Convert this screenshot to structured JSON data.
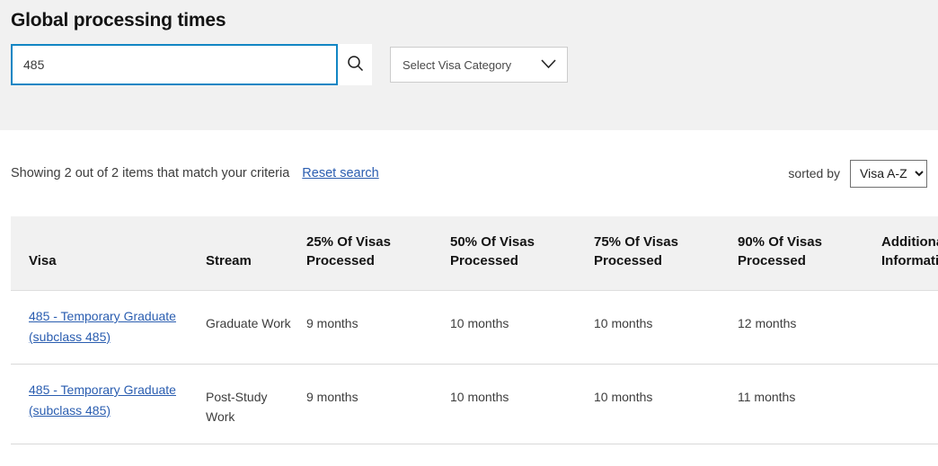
{
  "header": {
    "title": "Global processing times"
  },
  "search": {
    "value": "485",
    "placeholder": "",
    "search_icon": "search-icon",
    "category_label": "Select Visa Category",
    "category_caret": "chevron-down-icon"
  },
  "results": {
    "count_text": "Showing 2 out of 2 items that match your criteria",
    "reset_label": "Reset search",
    "sorted_by_label": "sorted by",
    "sort_value": "Visa A-Z",
    "sort_options": [
      "Visa A-Z"
    ]
  },
  "table": {
    "columns": [
      "Visa",
      "Stream",
      "25% Of Visas Processed",
      "50% Of Visas Processed",
      "75% Of Visas Processed",
      "90% Of Visas Processed",
      "Additional Information"
    ],
    "rows": [
      {
        "visa": "485 - Temporary Graduate (subclass 485)",
        "stream": "Graduate Work",
        "p25": "9 months",
        "p50": "10 months",
        "p75": "10 months",
        "p90": "12 months",
        "additional": ""
      },
      {
        "visa": "485 - Temporary Graduate (subclass 485)",
        "stream": "Post-Study Work",
        "p25": "9 months",
        "p50": "10 months",
        "p75": "10 months",
        "p90": "11 months",
        "additional": ""
      }
    ]
  },
  "colors": {
    "link": "#2a5db0",
    "focus_border": "#1286c4",
    "band_bg": "#f1f1f1"
  }
}
